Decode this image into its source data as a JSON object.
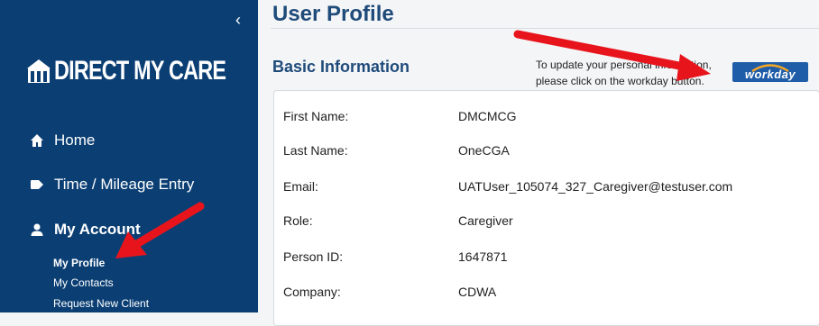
{
  "sidebar": {
    "brand": "DIRECT MY CARE",
    "nav": [
      {
        "label": "Home",
        "icon": "home-icon"
      },
      {
        "label": "Time / Mileage Entry",
        "icon": "tag-icon"
      },
      {
        "label": "My Account",
        "icon": "user-icon"
      }
    ],
    "sub_items": [
      {
        "label": "My Profile",
        "active": true
      },
      {
        "label": "My Contacts"
      },
      {
        "label": "Request New Client"
      }
    ]
  },
  "main": {
    "title": "User Profile",
    "section_title": "Basic Information",
    "update_note": "To update your personal information, please click on the workday button.",
    "workday_label": "workday",
    "fields": [
      {
        "label": "First Name:",
        "value": "DMCMCG"
      },
      {
        "label": "Last Name:",
        "value": "OneCGA"
      },
      {
        "label": "Email:",
        "value": "UATUser_105074_327_Caregiver@testuser.com"
      },
      {
        "label": "Role:",
        "value": "Caregiver"
      },
      {
        "label": "Person ID:",
        "value": "1647871"
      },
      {
        "label": "Company:",
        "value": "CDWA"
      }
    ]
  },
  "colors": {
    "sidebar": "#0b3f74",
    "heading": "#1f4b7a",
    "arrow": "#e8141c",
    "workday": "#1f5da8"
  }
}
